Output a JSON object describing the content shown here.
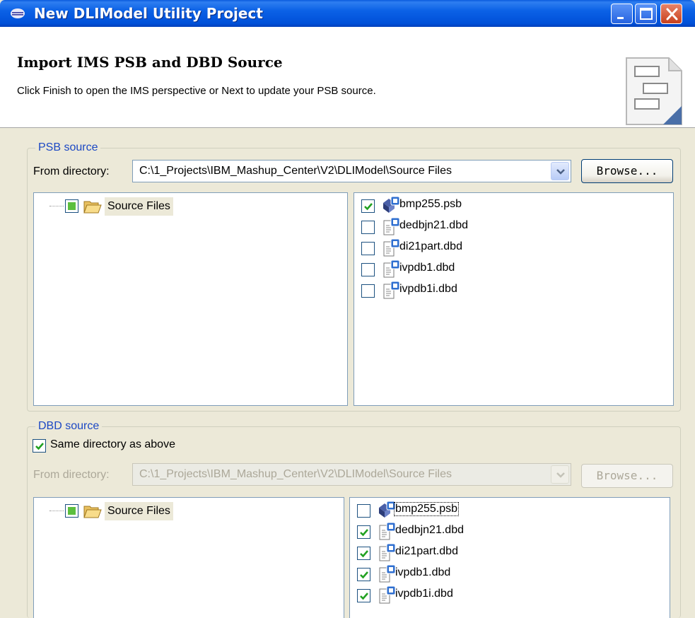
{
  "window": {
    "title": "New DLIModel Utility Project"
  },
  "header": {
    "title": "Import IMS PSB and DBD Source",
    "description": "Click Finish to open the IMS perspective or Next to update your PSB source."
  },
  "psb": {
    "legend": "PSB source",
    "dir_label": "From directory:",
    "dir_value": "C:\\1_Projects\\IBM_Mashup_Center\\V2\\DLIModel\\Source Files",
    "browse_label": "Browse...",
    "tree_label": "Source Files",
    "files": [
      {
        "name": "bmp255.psb",
        "checked": true,
        "icon": "psb-icon"
      },
      {
        "name": "dedbjn21.dbd",
        "checked": false,
        "icon": "dbd-icon"
      },
      {
        "name": "di21part.dbd",
        "checked": false,
        "icon": "dbd-icon"
      },
      {
        "name": "ivpdb1.dbd",
        "checked": false,
        "icon": "dbd-icon"
      },
      {
        "name": "ivpdb1i.dbd",
        "checked": false,
        "icon": "dbd-icon"
      }
    ]
  },
  "dbd": {
    "legend": "DBD source",
    "same_dir_label": "Same directory as above",
    "same_dir_checked": true,
    "dir_label": "From directory:",
    "dir_value": "C:\\1_Projects\\IBM_Mashup_Center\\V2\\DLIModel\\Source Files",
    "browse_label": "Browse...",
    "tree_label": "Source Files",
    "files": [
      {
        "name": "bmp255.psb",
        "checked": false,
        "icon": "psb-icon"
      },
      {
        "name": "dedbjn21.dbd",
        "checked": true,
        "icon": "dbd-icon"
      },
      {
        "name": "di21part.dbd",
        "checked": true,
        "icon": "dbd-icon"
      },
      {
        "name": "ivpdb1.dbd",
        "checked": true,
        "icon": "dbd-icon"
      },
      {
        "name": "ivpdb1i.dbd",
        "checked": true,
        "icon": "dbd-icon"
      }
    ]
  },
  "colors": {
    "titlebar": "#0054e3",
    "legend": "#1c48c4",
    "checkmark": "#21a121",
    "dialog_bg": "#ece9d8"
  }
}
